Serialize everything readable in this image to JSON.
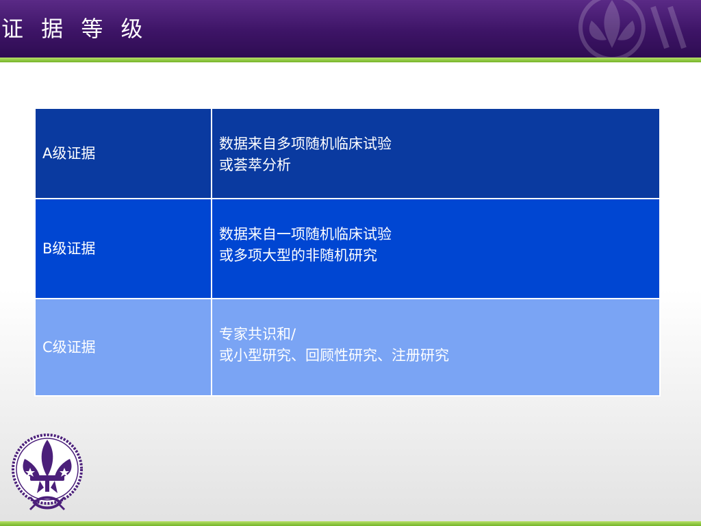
{
  "slide": {
    "title": "证 据 等 级"
  },
  "table": {
    "rows": [
      {
        "label": "A级证据",
        "desc_line1": "数据来自多项随机临床试验",
        "desc_line2": "或荟萃分析"
      },
      {
        "label": "B级证据",
        "desc_line1": "数据来自一项随机临床试验",
        "desc_line2": "或多项大型的非随机研究"
      },
      {
        "label": "C级证据",
        "desc_line1": "专家共识和/",
        "desc_line2": "或小型研究、回顾性研究、注册研究"
      }
    ]
  },
  "colors": {
    "header_purple": "#3d1466",
    "accent_green": "#8cc63f",
    "row_a_blue": "#0a3aa0",
    "row_b_blue": "#0046d2",
    "row_c_blue": "#7aa4f4",
    "emblem_purple": "#4b1f7a"
  },
  "icons": {
    "emblem": "fleur-de-lis-emblem-icon",
    "watermark": "fleur-de-lis-watermark-icon"
  }
}
